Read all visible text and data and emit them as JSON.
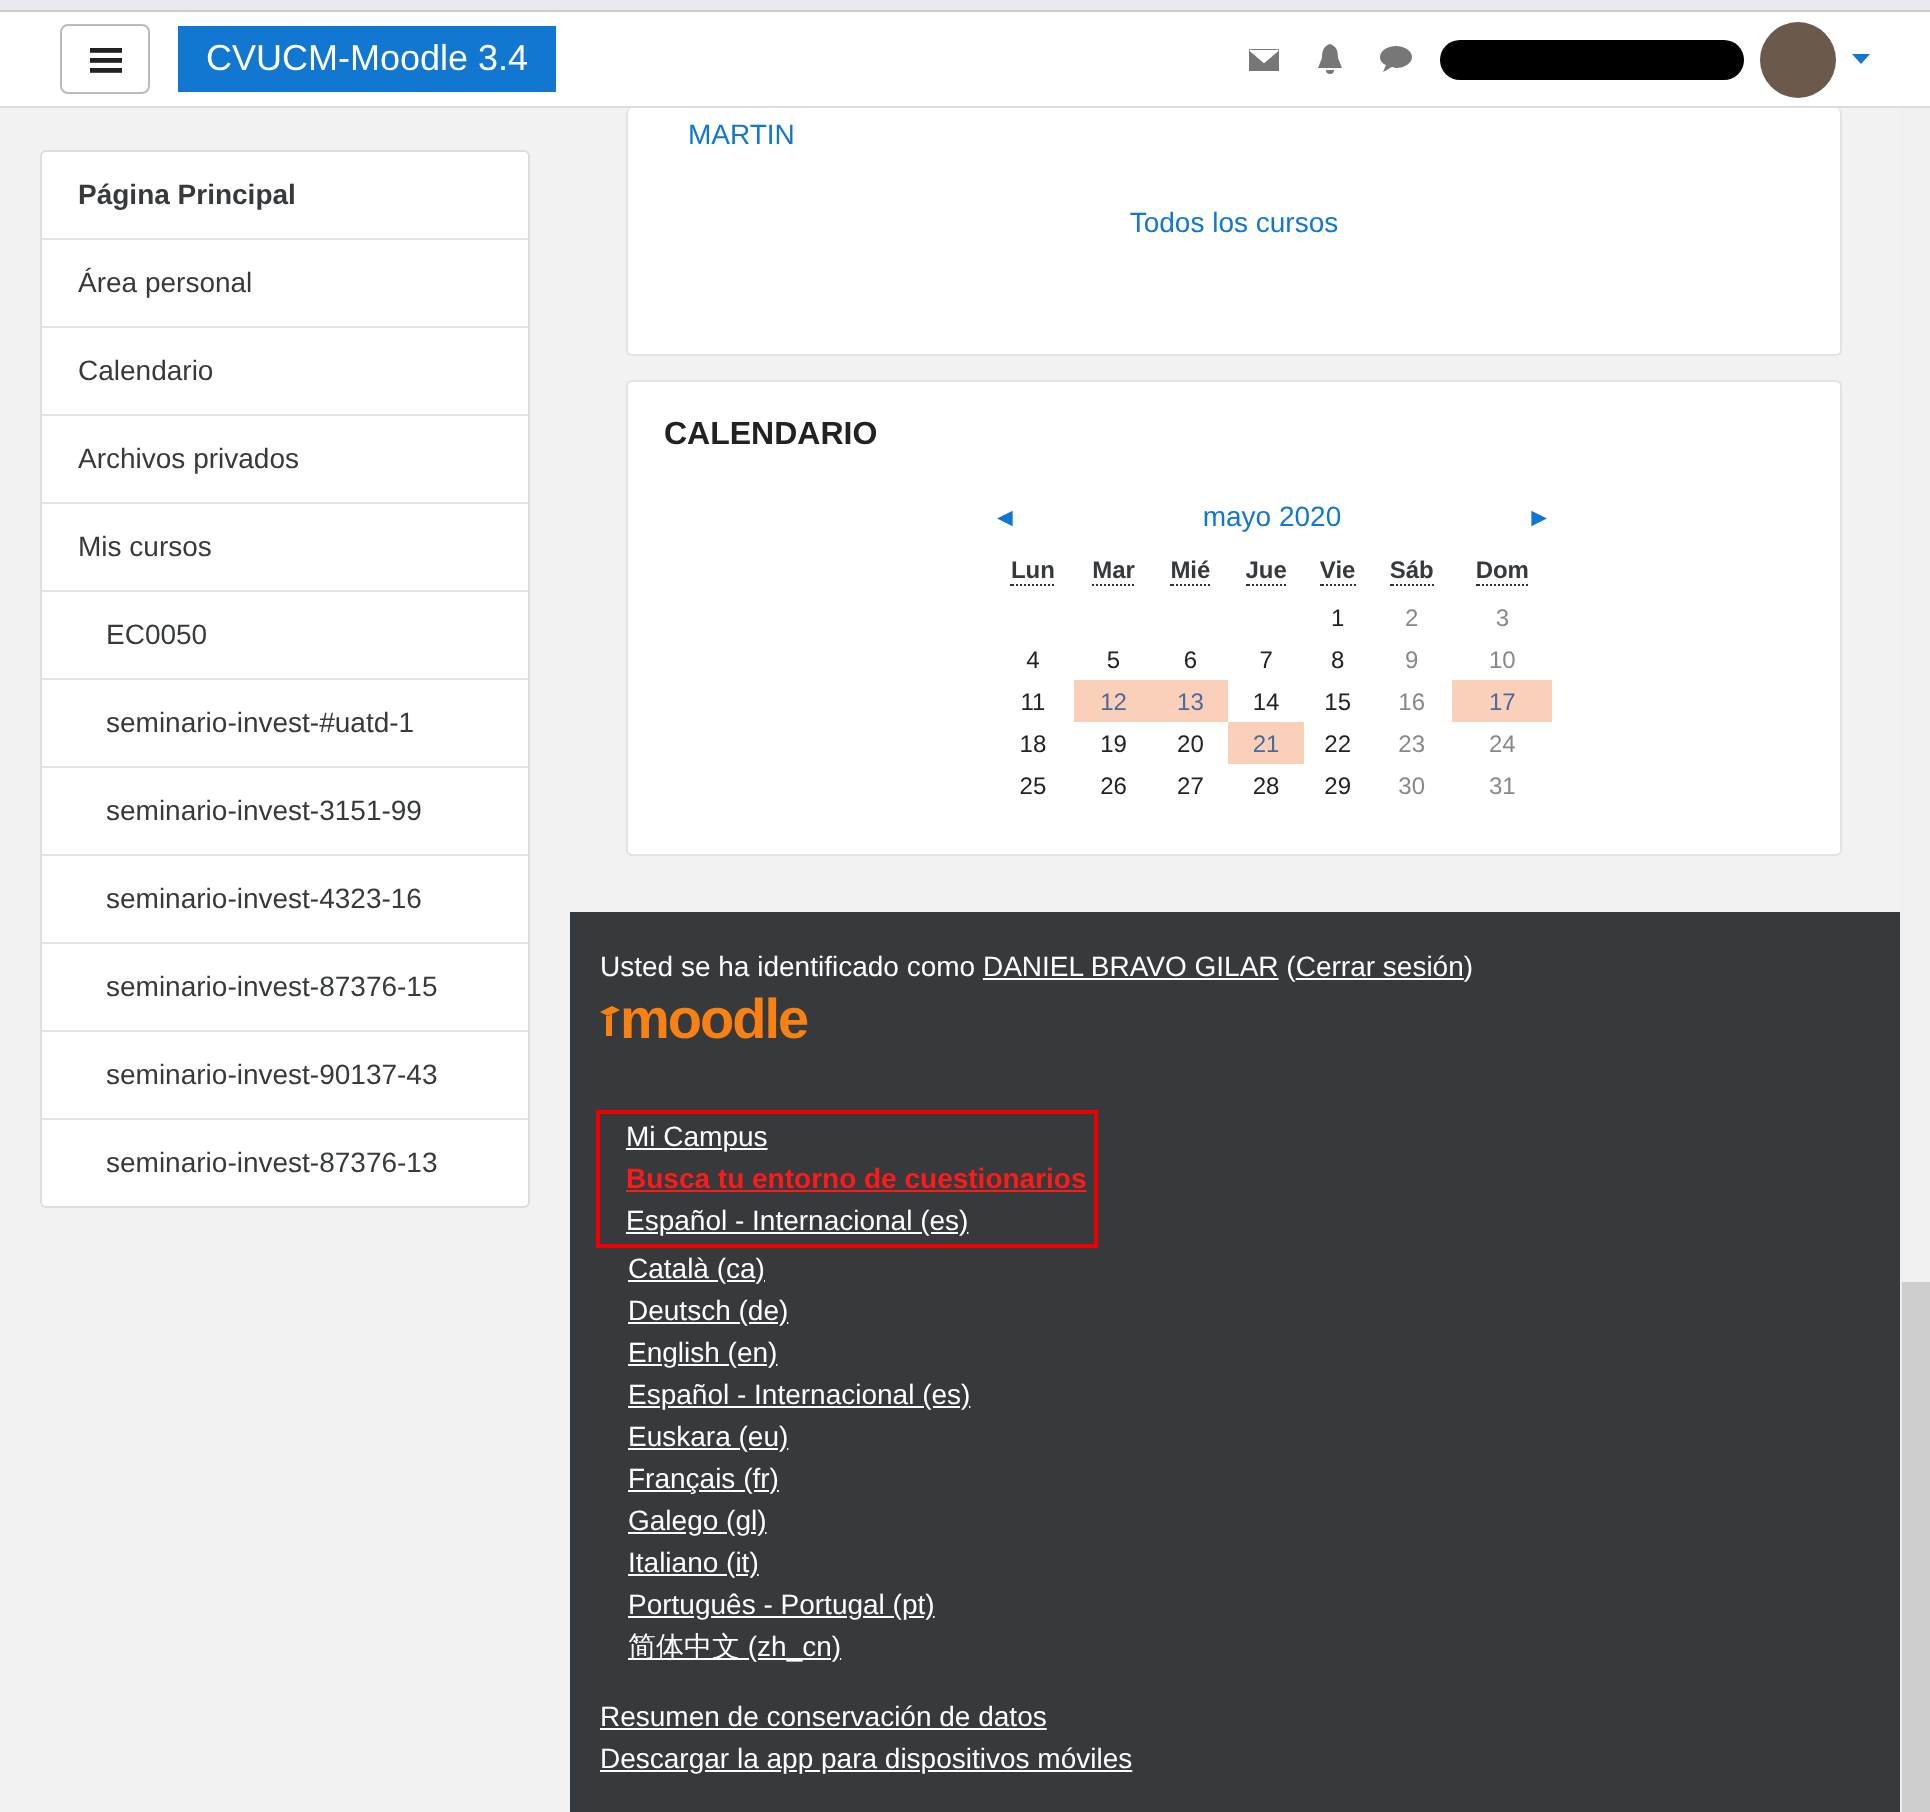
{
  "navbar": {
    "brand": "CVUCM-Moodle 3.4"
  },
  "sidebar": {
    "items": [
      {
        "label": "Página Principal",
        "selected": true
      },
      {
        "label": "Área personal",
        "selected": false
      },
      {
        "label": "Calendario",
        "selected": false
      },
      {
        "label": "Archivos privados",
        "selected": false
      },
      {
        "label": "Mis cursos",
        "selected": false,
        "children": [
          {
            "label": "EC0050",
            "selected": false
          },
          {
            "label": "seminario-invest-#uatd-1",
            "selected": false
          },
          {
            "label": "seminario-invest-3151-99",
            "selected": false
          },
          {
            "label": "seminario-invest-4323-16",
            "selected": false
          },
          {
            "label": "seminario-invest-87376-15",
            "selected": false
          },
          {
            "label": "seminario-invest-90137-43",
            "selected": false
          },
          {
            "label": "seminario-invest-87376-13",
            "selected": false
          }
        ]
      }
    ]
  },
  "courses_card": {
    "teacher": "MARTIN",
    "all_courses_link": "Todos los cursos"
  },
  "calendar": {
    "title": "CALENDARIO",
    "prev": "◄",
    "month": "mayo 2020",
    "next": "►",
    "weekdays": [
      "Lun",
      "Mar",
      "Mié",
      "Jue",
      "Vie",
      "Sáb",
      "Dom"
    ],
    "weeks": [
      {
        "leading_gap": true,
        "days": [
          {
            "day": "1",
            "event": false
          },
          {
            "day": "2",
            "event": false
          },
          {
            "day": "3",
            "event": false
          }
        ]
      },
      {
        "days": [
          {
            "day": "4",
            "event": false
          },
          {
            "day": "5",
            "event": false
          },
          {
            "day": "6",
            "event": false
          },
          {
            "day": "7",
            "event": false
          },
          {
            "day": "8",
            "event": false
          },
          {
            "day": "9",
            "event": false
          },
          {
            "day": "10",
            "event": false
          }
        ]
      },
      {
        "days": [
          {
            "day": "11",
            "event": false
          },
          {
            "day": "12",
            "event": true
          },
          {
            "day": "13",
            "event": true
          },
          {
            "day": "14",
            "event": false
          },
          {
            "day": "15",
            "event": false
          },
          {
            "day": "16",
            "event": false
          },
          {
            "day": "17",
            "event": true
          }
        ]
      },
      {
        "days": [
          {
            "day": "18",
            "event": false
          },
          {
            "day": "19",
            "event": false
          },
          {
            "day": "20",
            "event": false
          },
          {
            "day": "21",
            "event": true
          },
          {
            "day": "22",
            "event": false
          },
          {
            "day": "23",
            "event": false
          },
          {
            "day": "24",
            "event": false
          }
        ]
      },
      {
        "days": [
          {
            "day": "25",
            "event": false
          },
          {
            "day": "26",
            "event": false
          },
          {
            "day": "27",
            "event": false
          },
          {
            "day": "28",
            "event": false
          },
          {
            "day": "29",
            "event": false
          },
          {
            "day": "30",
            "event": false
          },
          {
            "day": "31",
            "event": false
          }
        ]
      }
    ]
  },
  "footer": {
    "login_text": "Usted se ha identificado como",
    "user_link": "DANIEL BRAVO GILAR",
    "logout_open": "(",
    "logout_link": "Cerrar sesión",
    "logout_close": ")",
    "logo": "moodle",
    "highlighted_links": [
      {
        "text": "Mi Campus",
        "kind": "normal"
      },
      {
        "text": "Busca tu entorno de cuestionarios",
        "kind": "alert"
      },
      {
        "text": "Español - Internacional (es)",
        "kind": "normal"
      }
    ],
    "languages": [
      "Català (ca)",
      "Deutsch (de)",
      "English (en)",
      "Español - Internacional (es)",
      "Euskara (eu)",
      "Français (fr)",
      "Galego (gl)",
      "Italiano (it)",
      "Português - Portugal (pt)",
      "简体中文 (zh_cn)"
    ],
    "bottom_links": [
      "Resumen de conservación de datos",
      "Descargar la app para dispositivos móviles"
    ]
  }
}
